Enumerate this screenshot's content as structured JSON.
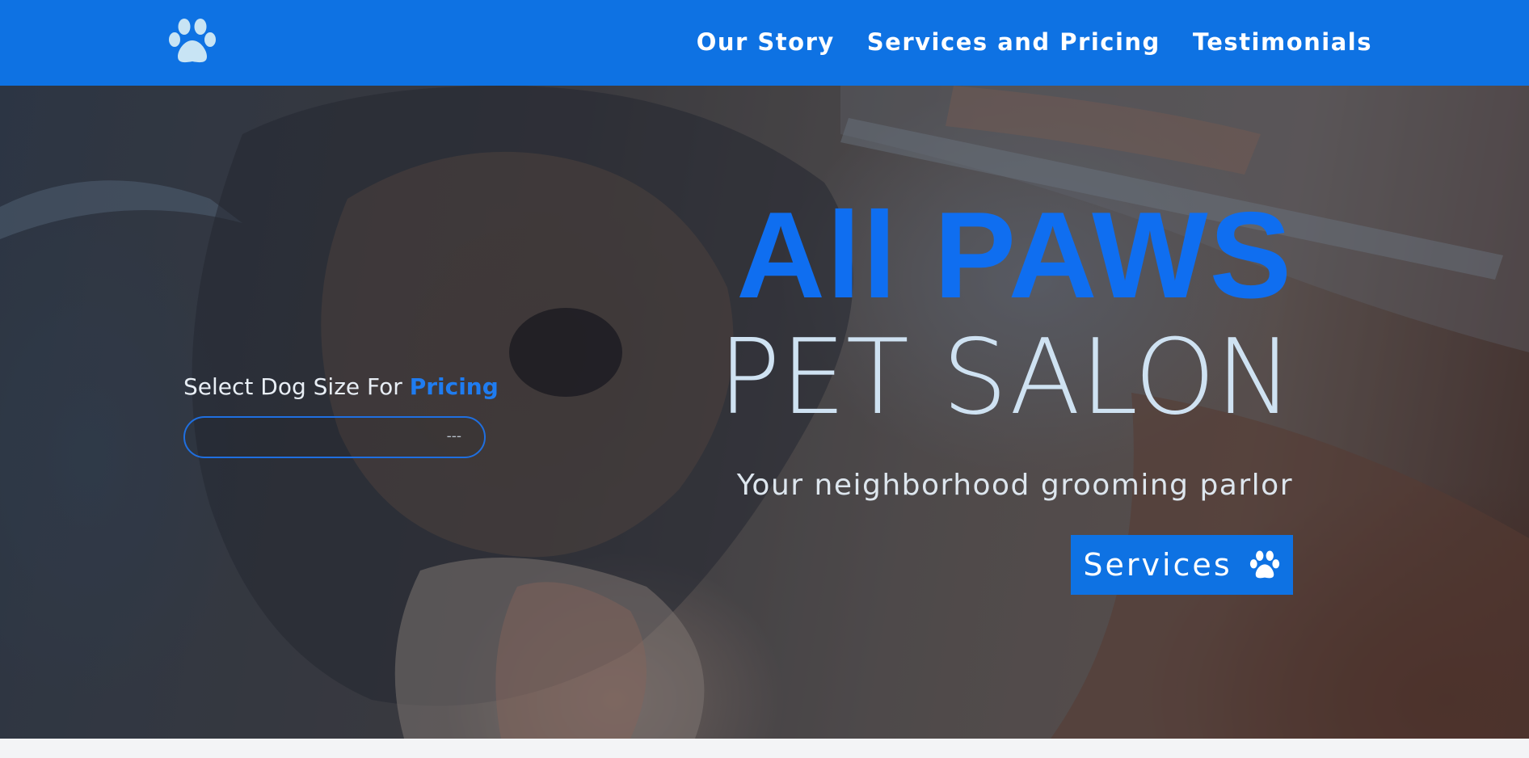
{
  "nav": {
    "logo_icon": "paw-icon",
    "links": [
      {
        "label": "Our Story"
      },
      {
        "label": "Services and Pricing"
      },
      {
        "label": "Testimonials"
      }
    ]
  },
  "pricing": {
    "label_prefix": "Select Dog Size For",
    "label_accent": "Pricing",
    "select_value": "---"
  },
  "hero": {
    "title": "All PAWS",
    "subtitle": "PET SALON",
    "tagline": "Your neighborhood grooming parlor",
    "cta_label": "Services",
    "cta_icon": "paw-icon"
  },
  "colors": {
    "brand_blue": "#0e72e3",
    "title_blue": "#0f6ef0",
    "subtitle": "#cfe2f2",
    "footer": "#f3f4f6"
  }
}
